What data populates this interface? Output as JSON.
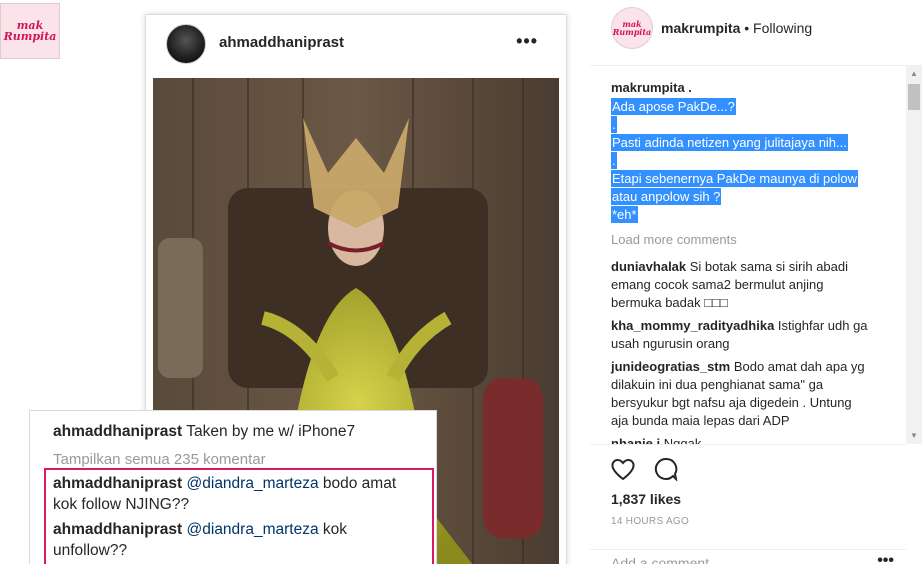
{
  "logo": {
    "line1": "mak",
    "line2": "Rumpita"
  },
  "post": {
    "username": "ahmaddhaniprast",
    "menu": "•••",
    "caption_user": "ahmaddhaniprast",
    "caption_text": "Taken by me w/ iPhone7",
    "view_all": "Tampilkan semua 235 komentar",
    "comments": [
      {
        "user": "ahmaddhaniprast",
        "mention": "@diandra_marteza",
        "text1": "bodo amat",
        "text2": "kok follow NJING??"
      },
      {
        "user": "ahmaddhaniprast",
        "mention": "@diandra_marteza",
        "text1": "kok",
        "text2": "unfollow??"
      }
    ]
  },
  "panel": {
    "username": "makrumpita",
    "follow_status": "• Following",
    "caption_author": "makrumpita .",
    "caption_lines": [
      "Ada apose PakDe...?",
      ".",
      "Pasti adinda netizen yang julitajaya nih...",
      ".",
      "Etapi sebenernya PakDe maunya di polow",
      "atau anpolow sih ?",
      "*eh*"
    ],
    "load_more": "Load more comments",
    "comments": [
      {
        "user": "duniavhalak",
        "lines": [
          "Si botak sama si sirih abadi",
          "emang cocok sama2 bermulut anjing",
          "bermuka badak □□□"
        ]
      },
      {
        "user": "kha_mommy_radityadhika",
        "lines": [
          "Istighfar udh ga",
          "usah ngurusin orang"
        ]
      },
      {
        "user": "junideogratias_stm",
        "lines": [
          "Bodo amat dah apa yg",
          "dilakuin ini dua penghianat sama\" ga",
          "bersyukur bgt nafsu aja digedein . Untung",
          "aja bunda maia lepas dari ADP"
        ]
      },
      {
        "user": "nhanie.i",
        "lines": [
          "Nggak"
        ]
      }
    ],
    "likes": "1,837 likes",
    "time_ago": "14 HOURS AGO",
    "add_comment_placeholder": "Add a comment...",
    "add_menu": "•••"
  },
  "colors": {
    "selection": "#3390ff",
    "highlight_border": "#d81b60",
    "mention": "#003569",
    "brand_pink": "#d2145a"
  },
  "icons": [
    "heart-icon",
    "comment-icon",
    "more-options-icon",
    "scroll-up-arrow",
    "scroll-down-arrow"
  ]
}
